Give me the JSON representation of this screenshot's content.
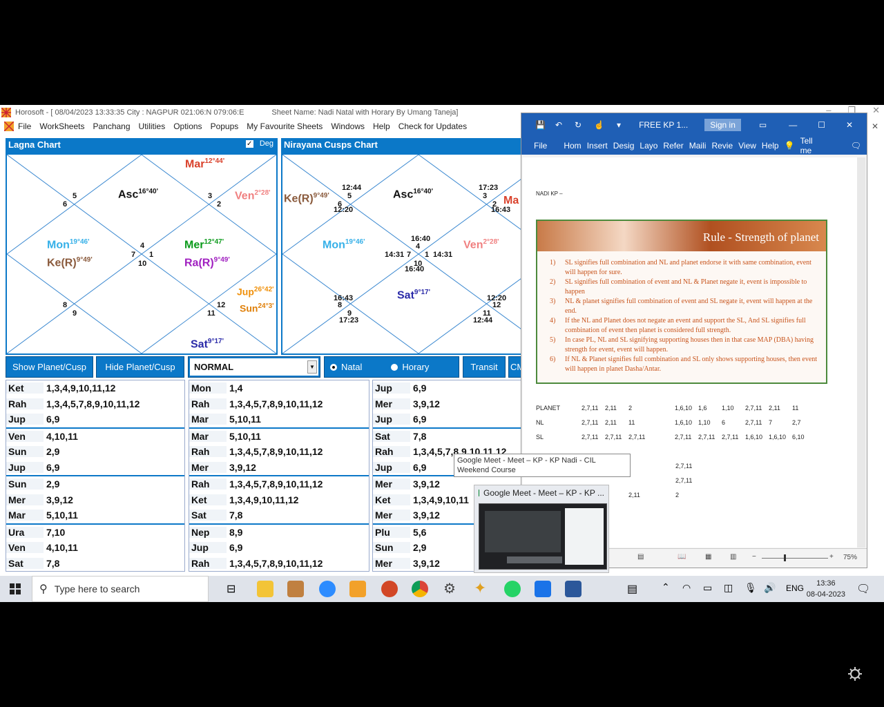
{
  "app": {
    "title": "Horosoft - [ 08/04/2023 13:33:35  City : NAGPUR 021:06:N 079:06:E",
    "sheet": "Sheet Name: Nadi Natal with Horary By Umang Taneja]",
    "menu": [
      "File",
      "WorkSheets",
      "Panchang",
      "Utilities",
      "Options",
      "Popups",
      "My Favourite Sheets",
      "Windows",
      "Help",
      "Check for Updates"
    ]
  },
  "lagna": {
    "title": "Lagna Chart",
    "deg_label": "Deg",
    "planets": [
      {
        "n": "Mar",
        "d": "12°44'",
        "c": "#d9412b"
      },
      {
        "n": "Asc",
        "d": "16°40'",
        "c": "#111"
      },
      {
        "n": "Ven",
        "d": "2°28'",
        "c": "#f08080"
      },
      {
        "n": "Mon",
        "d": "19°46'",
        "c": "#36b0e8"
      },
      {
        "n": "Ke(R)",
        "d": "9°49'",
        "c": "#8a5a3c"
      },
      {
        "n": "Mer",
        "d": "12°47'",
        "c": "#0a9a1a"
      },
      {
        "n": "Ra(R)",
        "d": "9°49'",
        "c": "#a020c0"
      },
      {
        "n": "Jup",
        "d": "26°42'",
        "c": "#f0900a"
      },
      {
        "n": "Sun",
        "d": "24°3'",
        "c": "#e0800a"
      },
      {
        "n": "Sat",
        "d": "9°17'",
        "c": "#2a2aa8"
      }
    ],
    "houses": [
      "5",
      "6",
      "3",
      "2",
      "4",
      "7",
      "1",
      "10",
      "8",
      "9",
      "12",
      "11"
    ]
  },
  "cusps": {
    "title": "Nirayana Cusps Chart",
    "planets": [
      {
        "n": "Ke(R)",
        "d": "9°49'",
        "c": "#8a5a3c"
      },
      {
        "n": "Asc",
        "d": "16°40'",
        "c": "#111"
      },
      {
        "n": "Ma",
        "d": "",
        "c": "#d9412b"
      },
      {
        "n": "Mon",
        "d": "19°46'",
        "c": "#36b0e8"
      },
      {
        "n": "Ven",
        "d": "2°28'",
        "c": "#f08080"
      },
      {
        "n": "Sat",
        "d": "9°17'",
        "c": "#2a2aa8"
      }
    ],
    "labels": [
      "12:44",
      "5",
      "6",
      "12:20",
      "17:23",
      "3",
      "2",
      "16:43",
      "16:40",
      "4",
      "14:31",
      "7",
      "1",
      "14:31",
      "10",
      "16:40",
      "16:43",
      "8",
      "9",
      "17:23",
      "12:20",
      "12",
      "11",
      "12:44"
    ]
  },
  "buttons": {
    "show": "Show Planet/Cusp",
    "hide": "Hide Planet/Cusp",
    "select": "NORMAL",
    "natal": "Natal",
    "horary": "Horary",
    "transit": "Transit",
    "cm": "CM"
  },
  "tables": [
    [
      [
        [
          "Ket",
          "1,3,4,9,10,11,12"
        ],
        [
          "Rah",
          "1,3,4,5,7,8,9,10,11,12"
        ],
        [
          "Jup",
          "6,9"
        ]
      ],
      [
        [
          "Ven",
          "4,10,11"
        ],
        [
          "Sun",
          "2,9"
        ],
        [
          "Jup",
          "6,9"
        ]
      ],
      [
        [
          "Sun",
          "2,9"
        ],
        [
          "Mer",
          "3,9,12"
        ],
        [
          "Mar",
          "5,10,11"
        ]
      ],
      [
        [
          "Ura",
          "7,10"
        ],
        [
          "Ven",
          "4,10,11"
        ],
        [
          "Sat",
          "7,8"
        ]
      ]
    ],
    [
      [
        [
          "Mon",
          "1,4"
        ],
        [
          "Rah",
          "1,3,4,5,7,8,9,10,11,12"
        ],
        [
          "Mar",
          "5,10,11"
        ]
      ],
      [
        [
          "Mar",
          "5,10,11"
        ],
        [
          "Rah",
          "1,3,4,5,7,8,9,10,11,12"
        ],
        [
          "Mer",
          "3,9,12"
        ]
      ],
      [
        [
          "Rah",
          "1,3,4,5,7,8,9,10,11,12"
        ],
        [
          "Ket",
          "1,3,4,9,10,11,12"
        ],
        [
          "Sat",
          "7,8"
        ]
      ],
      [
        [
          "Nep",
          "8,9"
        ],
        [
          "Jup",
          "6,9"
        ],
        [
          "Rah",
          "1,3,4,5,7,8,9,10,11,12"
        ]
      ]
    ],
    [
      [
        [
          "Jup",
          "6,9"
        ],
        [
          "Mer",
          "3,9,12"
        ],
        [
          "Jup",
          "6,9"
        ]
      ],
      [
        [
          "Sat",
          "7,8"
        ],
        [
          "Rah",
          "1,3,4,5,7,8,9,10,11,12"
        ],
        [
          "Jup",
          "6,9"
        ]
      ],
      [
        [
          "Mer",
          "3,9,12"
        ],
        [
          "Ket",
          "1,3,4,9,10,11"
        ],
        [
          "Mer",
          "3,9,12"
        ]
      ],
      [
        [
          "Plu",
          "5,6"
        ],
        [
          "Sun",
          "2,9"
        ],
        [
          "Mer",
          "3,9,12"
        ]
      ]
    ]
  ],
  "word": {
    "title": "FREE KP 1...",
    "signin": "Sign in",
    "ribbon": [
      "File",
      "Hom",
      "Insert",
      "Desig",
      "Layo",
      "Refer",
      "Maili",
      "Revie",
      "View",
      "Help",
      "Tell me"
    ],
    "doc_heading": "NADI KP –",
    "rule_title": "Rule - Strength of planet",
    "rules": [
      {
        "n": "1)",
        "t": "SL signifies full combination and NL and planet endorse it with same combination, event will happen for sure."
      },
      {
        "n": "2)",
        "t": "SL signifies full combination of event and NL & Planet negate it, event is impossible to happen"
      },
      {
        "n": "3)",
        "t": "NL & planet signifies full combination of event and SL negate it, event will happen at the end."
      },
      {
        "n": "4)",
        "t": "If the NL and Planet does not negate an event and support the SL, And SL signifies full combination of event then planet is considered full strength."
      },
      {
        "n": "5)",
        "t": "In case PL, NL and SL signifying supporting houses then in that case MAP (DBA) having strength for event, event will happen."
      },
      {
        "n": "6)",
        "t": "If NL & Planet signifies full combination and SL only shows supporting houses, then event will happen in planet Dasha/Antar."
      }
    ],
    "grid": [
      {
        "label": "PLANET",
        "cells": [
          "2,7,11",
          "2,11",
          "2",
          "",
          "1,6,10",
          "1,6",
          "1,10",
          "2,7,11",
          "2,11",
          "11"
        ]
      },
      {
        "label": "NL",
        "cells": [
          "2,7,11",
          "2,11",
          "11",
          "",
          "1,6,10",
          "1,10",
          "6",
          "2,7,11",
          "7",
          "2,7"
        ]
      },
      {
        "label": "SL",
        "cells": [
          "2,7,11",
          "2,7,11",
          "2,7,11",
          "",
          "2,7,11",
          "2,7,11",
          "2,7,11",
          "1,6,10",
          "1,6,10",
          "6,10"
        ]
      }
    ],
    "grid2": [
      "2,7,11",
      "2,7,11",
      "2,11",
      "2"
    ],
    "zoom": "75%"
  },
  "tooltip": "Google Meet - Meet – KP - KP Nadi - CIL Weekend Course",
  "preview_title": "Google Meet - Meet – KP - KP ...",
  "taskbar": {
    "search": "Type here to search",
    "lang": "ENG",
    "time": "13:36",
    "date": "08-04-2023"
  }
}
